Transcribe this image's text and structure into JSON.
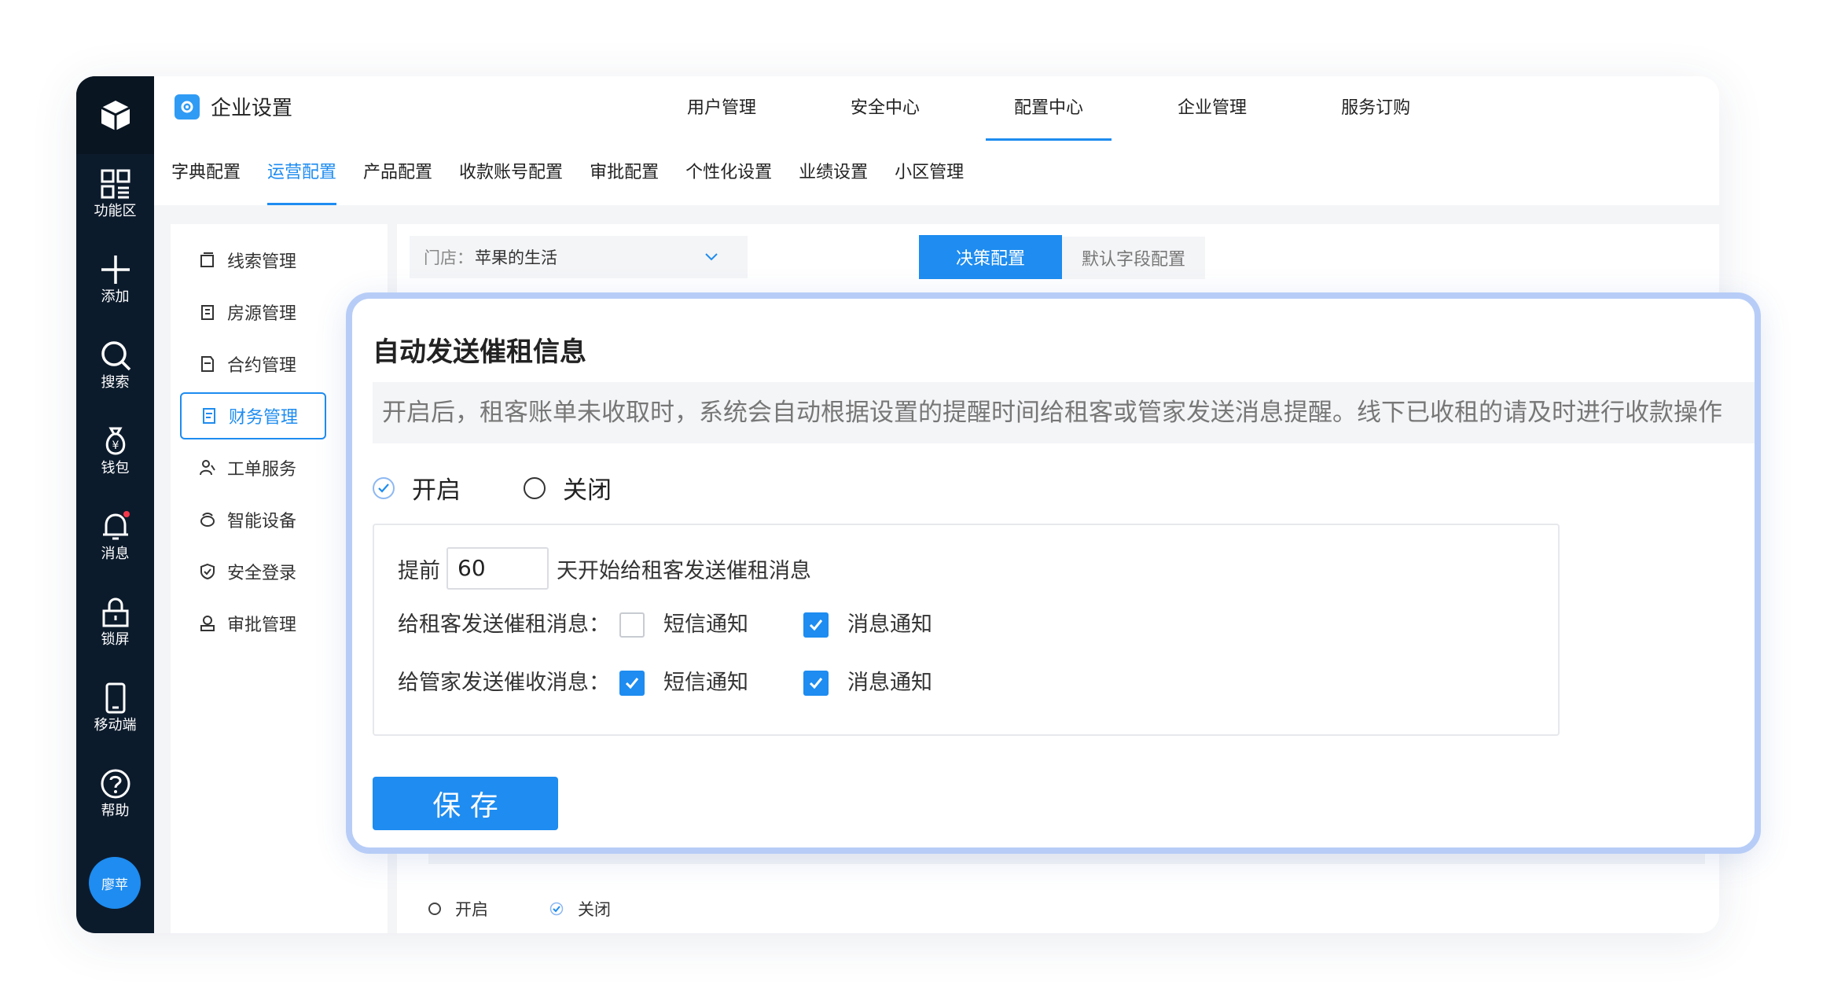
{
  "rail": {
    "items": [
      {
        "label": "功能区",
        "icon": "grid-icon"
      },
      {
        "label": "添加",
        "icon": "plus-icon"
      },
      {
        "label": "搜索",
        "icon": "search-icon"
      },
      {
        "label": "钱包",
        "icon": "wallet-icon"
      },
      {
        "label": "消息",
        "icon": "bell-icon"
      },
      {
        "label": "锁屏",
        "icon": "lock-icon"
      },
      {
        "label": "移动端",
        "icon": "mobile-icon"
      },
      {
        "label": "帮助",
        "icon": "help-icon"
      }
    ],
    "avatar": "廖苹",
    "notification_color": "#f5394a"
  },
  "header": {
    "brand": "企业设置",
    "nav": [
      "用户管理",
      "安全中心",
      "配置中心",
      "企业管理",
      "服务订购"
    ],
    "active_nav": "配置中心"
  },
  "subnav": {
    "items": [
      "字典配置",
      "运营配置",
      "产品配置",
      "收款账号配置",
      "审批配置",
      "个性化设置",
      "业绩设置",
      "小区管理"
    ],
    "active": "运营配置"
  },
  "sidebar": {
    "items": [
      "线索管理",
      "房源管理",
      "合约管理",
      "财务管理",
      "工单服务",
      "智能设备",
      "安全登录",
      "审批管理"
    ],
    "active": "财务管理"
  },
  "content": {
    "store_label": "门店：",
    "store_value": "苹果的生活",
    "tab_active": "决策配置",
    "tab_other": "默认字段配置",
    "bg_radio_on": "开启",
    "bg_radio_off": "关闭"
  },
  "popup": {
    "title": "自动发送催租信息",
    "description": "开启后，租客账单未收取时，系统会自动根据设置的提醒时间给租客或管家发送消息提醒。线下已收租的请及时进行收款操作",
    "radio_on": "开启",
    "radio_off": "关闭",
    "selected": "开启",
    "advance_prefix": "提前",
    "advance_days": "60",
    "advance_suffix": "天开始给租客发送催租消息",
    "tenant_label": "给租客发送催租消息：",
    "steward_label": "给管家发送催收消息：",
    "sms_label": "短信通知",
    "msg_label": "消息通知",
    "tenant_sms": false,
    "tenant_msg": true,
    "steward_sms": true,
    "steward_msg": true,
    "save_label": "保 存"
  },
  "colors": {
    "accent": "#1e8cf0",
    "rail": "#0c1b2c",
    "popup_border": "#b7cdf7"
  }
}
